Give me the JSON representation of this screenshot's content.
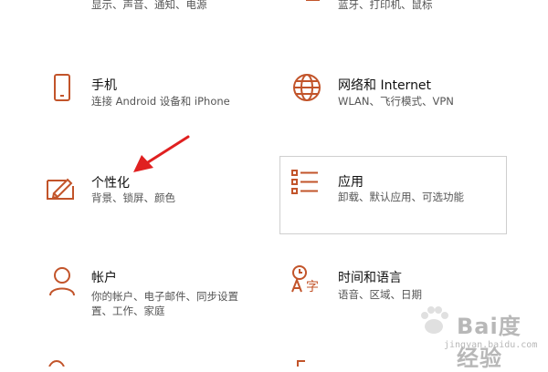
{
  "top_partial": {
    "left_desc": "显示、声音、通知、电源",
    "right_desc": "蓝牙、打印机、鼠标"
  },
  "tiles": [
    {
      "title": "手机",
      "desc": "连接 Android 设备和 iPhone",
      "icon": "phone-icon"
    },
    {
      "title": "网络和 Internet",
      "desc": "WLAN、飞行模式、VPN",
      "icon": "globe-icon"
    },
    {
      "title": "个性化",
      "desc": "背景、锁屏、颜色",
      "icon": "personalization-icon"
    },
    {
      "title": "应用",
      "desc": "卸载、默认应用、可选功能",
      "icon": "apps-list-icon"
    },
    {
      "title": "帐户",
      "desc_line1": "你的帐户、电子邮件、同步设置",
      "desc_line2": "置、工作、家庭",
      "icon": "person-icon"
    },
    {
      "title": "时间和语言",
      "desc": "语音、区域、日期",
      "icon": "time-language-icon"
    }
  ],
  "annotation": {
    "type": "arrow",
    "color": "#e02020",
    "points_to": "个性化"
  },
  "watermark": {
    "brand": "Bai度 经验",
    "url": "jingyan.baidu.com"
  },
  "colors": {
    "accent": "#c2542a",
    "hover_border": "#cfcfcf",
    "arrow": "#e02020"
  }
}
